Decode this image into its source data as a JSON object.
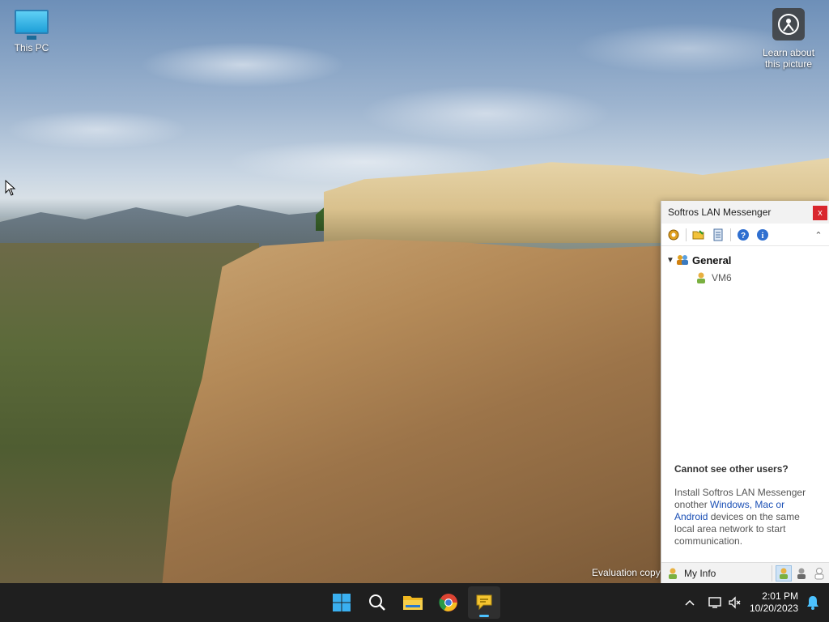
{
  "desktop": {
    "icons": [
      {
        "label": "This PC",
        "icon": "monitor-icon"
      },
      {
        "label": "Learn about\nthis picture",
        "icon": "learn-about-picture-icon"
      }
    ],
    "watermark": "Evaluation copy"
  },
  "messenger": {
    "title": "Softros LAN Messenger",
    "close_label": "x",
    "toolbar": [
      "settings-icon",
      "open-folder-icon",
      "message-log-icon",
      "help-icon",
      "info-icon"
    ],
    "groups": [
      {
        "name": "General",
        "users": [
          {
            "name": "VM6"
          }
        ]
      }
    ],
    "help": {
      "heading": "Cannot see other users?",
      "text_before": "Install Softros LAN Messenger onother ",
      "link": "Windows, Mac or Android",
      "text_after": " devices on the same local area network to start communication."
    },
    "status": {
      "my_info_label": "My Info",
      "statuses": [
        "available",
        "away",
        "offline"
      ],
      "active_status": "available"
    }
  },
  "taskbar": {
    "apps": [
      "start-icon",
      "search-icon",
      "file-explorer-icon",
      "chrome-icon",
      "softros-messenger-icon"
    ],
    "active_app": "softros-messenger-icon",
    "time": "2:01 PM",
    "date": "10/20/2023"
  },
  "colors": {
    "taskbar_bg": "#1f1f1f",
    "accent": "#4cc2ff",
    "close_red": "#d9272e",
    "link_blue": "#1a4fb5"
  }
}
